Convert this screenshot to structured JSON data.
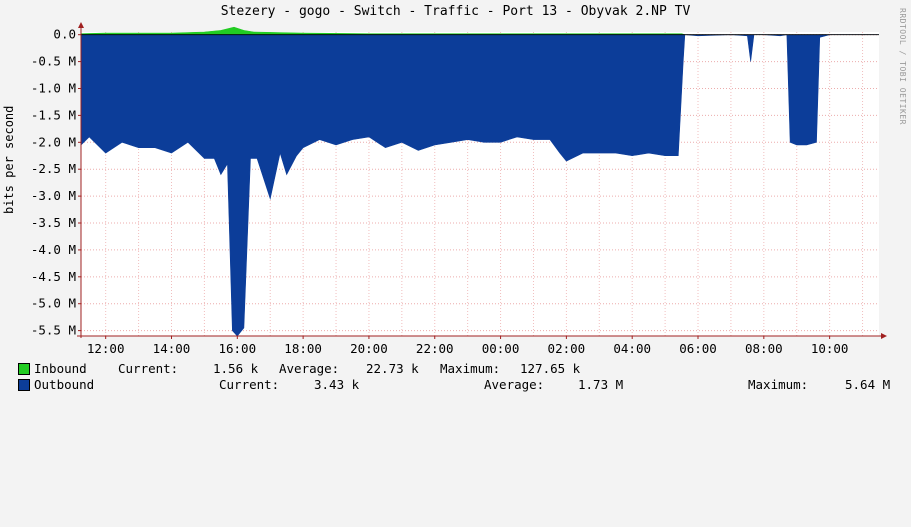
{
  "title": "Stezery - gogo - Switch - Traffic - Port 13 - Obyvak 2.NP TV",
  "watermark": "RRDTOOL / TOBI OETIKER",
  "colors": {
    "inbound": "#22cc22",
    "outbound": "#0c3d99",
    "grid": "#e58a8a",
    "axis": "#a02020"
  },
  "chart_data": {
    "type": "area",
    "title": "Stezery - gogo - Switch - Traffic - Port 13 - Obyvak 2.NP TV",
    "ylabel": "bits per second",
    "ylim": [
      -5.6,
      0.05
    ],
    "y_unit": "M",
    "y_ticks": [
      {
        "v": 0.0,
        "label": "0.0"
      },
      {
        "v": -0.5,
        "label": "-0.5 M"
      },
      {
        "v": -1.0,
        "label": "-1.0 M"
      },
      {
        "v": -1.5,
        "label": "-1.5 M"
      },
      {
        "v": -2.0,
        "label": "-2.0 M"
      },
      {
        "v": -2.5,
        "label": "-2.5 M"
      },
      {
        "v": -3.0,
        "label": "-3.0 M"
      },
      {
        "v": -3.5,
        "label": "-3.5 M"
      },
      {
        "v": -4.0,
        "label": "-4.0 M"
      },
      {
        "v": -4.5,
        "label": "-4.5 M"
      },
      {
        "v": -5.0,
        "label": "-5.0 M"
      },
      {
        "v": -5.5,
        "label": "-5.5 M"
      }
    ],
    "xlim": [
      11.25,
      35.5
    ],
    "x_ticks": [
      {
        "v": 12,
        "label": "12:00"
      },
      {
        "v": 14,
        "label": "14:00"
      },
      {
        "v": 16,
        "label": "16:00"
      },
      {
        "v": 18,
        "label": "18:00"
      },
      {
        "v": 20,
        "label": "20:00"
      },
      {
        "v": 22,
        "label": "22:00"
      },
      {
        "v": 24,
        "label": "00:00"
      },
      {
        "v": 26,
        "label": "02:00"
      },
      {
        "v": 28,
        "label": "04:00"
      },
      {
        "v": 30,
        "label": "06:00"
      },
      {
        "v": 32,
        "label": "08:00"
      },
      {
        "v": 34,
        "label": "10:00"
      }
    ],
    "series": [
      {
        "name": "Inbound",
        "x": [
          11.25,
          12.0,
          13.0,
          14.0,
          15.0,
          15.5,
          15.9,
          16.2,
          16.5,
          18.0,
          20.0,
          22.0,
          24.0,
          26.0,
          28.0,
          29.5,
          29.6
        ],
        "values": [
          0.02,
          0.03,
          0.03,
          0.03,
          0.05,
          0.08,
          0.14,
          0.08,
          0.05,
          0.03,
          0.02,
          0.02,
          0.02,
          0.02,
          0.02,
          0.02,
          0.0
        ]
      },
      {
        "name": "Outbound",
        "x": [
          11.25,
          11.5,
          12.0,
          12.5,
          13.0,
          13.5,
          14.0,
          14.5,
          15.0,
          15.3,
          15.5,
          15.7,
          15.85,
          16.0,
          16.2,
          16.4,
          16.6,
          17.0,
          17.3,
          17.5,
          17.8,
          18.0,
          18.5,
          19.0,
          19.5,
          20.0,
          20.5,
          21.0,
          21.5,
          22.0,
          22.5,
          23.0,
          23.5,
          24.0,
          24.5,
          25.0,
          25.5,
          25.8,
          26.0,
          26.5,
          27.0,
          27.5,
          28.0,
          28.5,
          29.0,
          29.4,
          29.55,
          29.6,
          30.0,
          31.0,
          31.5,
          31.6,
          31.7,
          32.0,
          32.5,
          32.7,
          32.8,
          33.0,
          33.3,
          33.6,
          33.7,
          34.0,
          35.5
        ],
        "values": [
          -2.05,
          -1.9,
          -2.2,
          -2.0,
          -2.1,
          -2.1,
          -2.2,
          -2.0,
          -2.3,
          -2.3,
          -2.6,
          -2.4,
          -5.5,
          -5.6,
          -5.45,
          -2.3,
          -2.3,
          -3.05,
          -2.2,
          -2.6,
          -2.25,
          -2.1,
          -1.95,
          -2.05,
          -1.95,
          -1.9,
          -2.1,
          -2.0,
          -2.15,
          -2.05,
          -2.0,
          -1.95,
          -2.0,
          -2.0,
          -1.9,
          -1.95,
          -1.95,
          -2.2,
          -2.35,
          -2.2,
          -2.2,
          -2.2,
          -2.25,
          -2.2,
          -2.25,
          -2.25,
          -0.5,
          0.0,
          -0.02,
          0.0,
          -0.02,
          -0.5,
          0.0,
          0.0,
          -0.02,
          0.0,
          -2.0,
          -2.05,
          -2.05,
          -2.0,
          -0.05,
          0.0,
          0.0
        ]
      }
    ]
  },
  "legend": [
    {
      "label": "Inbound",
      "current_label": "Current:",
      "current": "1.56 k",
      "average_label": "Average:",
      "average": "22.73 k",
      "maximum_label": "Maximum:",
      "maximum": "127.65 k"
    },
    {
      "label": "Outbound",
      "current_label": "Current:",
      "current": "3.43 k",
      "average_label": "Average:",
      "average": "1.73 M",
      "maximum_label": "Maximum:",
      "maximum": "5.64 M"
    }
  ]
}
